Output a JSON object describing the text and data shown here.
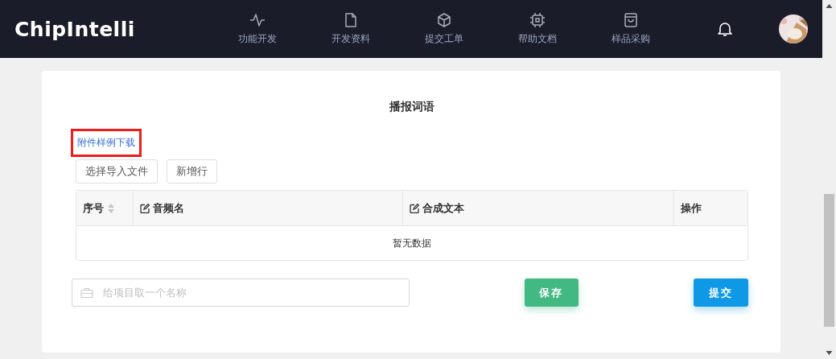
{
  "header": {
    "logo": "ChipIntelli",
    "nav": [
      {
        "label": "功能开发"
      },
      {
        "label": "开发资料"
      },
      {
        "label": "提交工单"
      },
      {
        "label": "帮助文档"
      },
      {
        "label": "样品采购"
      }
    ]
  },
  "panel": {
    "title": "播报词语",
    "download_link": {
      "label": "附件样例下载",
      "highlighted": true
    },
    "buttons": [
      "选择导入文件",
      "新增行"
    ],
    "table": {
      "columns": [
        {
          "label": "序号",
          "kind": "sortable"
        },
        {
          "label": "音频名",
          "kind": "editable"
        },
        {
          "label": "合成文本",
          "kind": "editable"
        },
        {
          "label": "操作",
          "kind": "plain"
        }
      ],
      "empty_text": "暂无数据"
    },
    "name_field": {
      "placeholder": "给项目取一个名称"
    },
    "actions": [
      {
        "label": "保存",
        "kind": "save"
      },
      {
        "label": "提交",
        "kind": "submit"
      }
    ]
  }
}
